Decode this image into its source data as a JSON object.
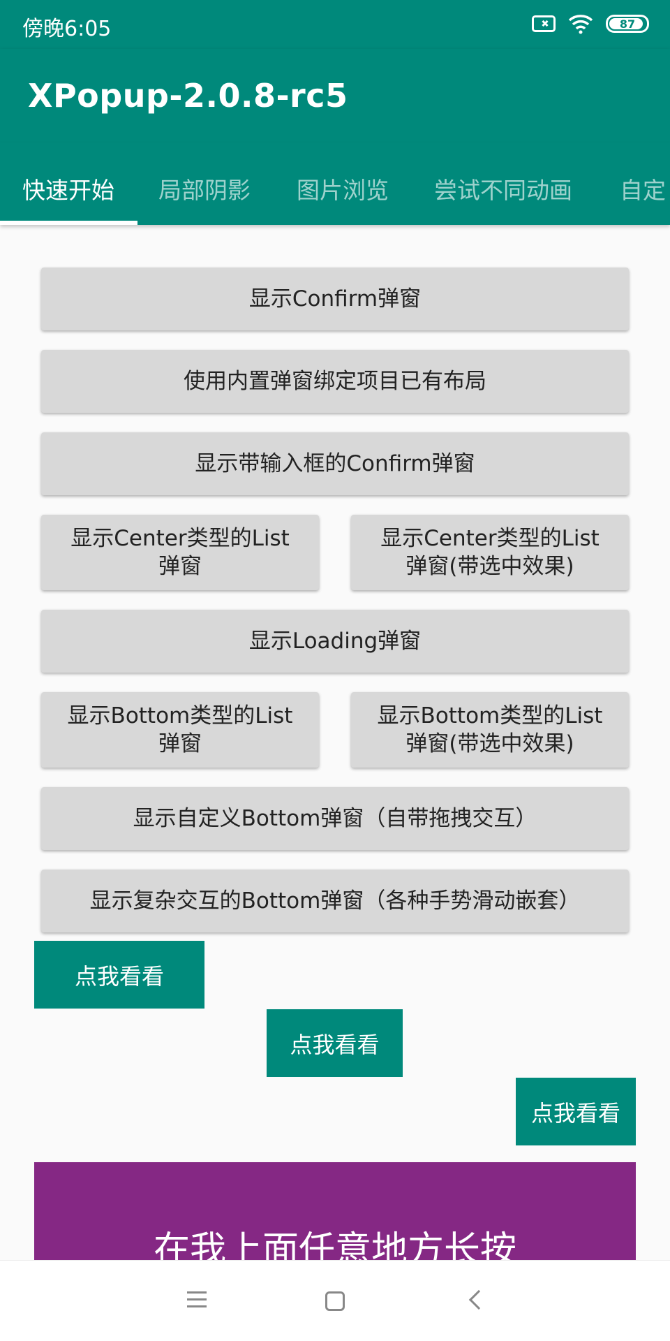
{
  "status_bar": {
    "time": "傍晚6:05",
    "battery": "87",
    "battery_level_percent": 87
  },
  "app_bar": {
    "title": "XPopup-2.0.8-rc5"
  },
  "tabs": [
    {
      "label": "快速开始",
      "active": true
    },
    {
      "label": "局部阴影",
      "active": false
    },
    {
      "label": "图片浏览",
      "active": false
    },
    {
      "label": "尝试不同动画",
      "active": false
    },
    {
      "label": "自定",
      "active": false
    }
  ],
  "buttons": {
    "confirm": "显示Confirm弹窗",
    "bind_layout": "使用内置弹窗绑定项目已有布局",
    "input_confirm": "显示带输入框的Confirm弹窗",
    "center_list": {
      "line1": "显示Center类型的List",
      "line2": "弹窗"
    },
    "center_list_check": {
      "line1": "显示Center类型的List",
      "line2": "弹窗(带选中效果)"
    },
    "loading": "显示Loading弹窗",
    "bottom_list": {
      "line1": "显示Bottom类型的List",
      "line2": "弹窗"
    },
    "bottom_list_check": {
      "line1": "显示Bottom类型的List",
      "line2": "弹窗(带选中效果)"
    },
    "custom_bottom": "显示自定义Bottom弹窗（自带拖拽交互）",
    "complex_bottom": "显示复杂交互的Bottom弹窗（各种手势滑动嵌套）"
  },
  "attach_buttons": [
    "点我看看",
    "点我看看",
    "点我看看"
  ],
  "long_press_area": {
    "label": "在我上面任意地方长按"
  },
  "colors": {
    "primary": "#00897b",
    "accent_purple": "#852884",
    "button_gray": "#d8d8d8"
  }
}
